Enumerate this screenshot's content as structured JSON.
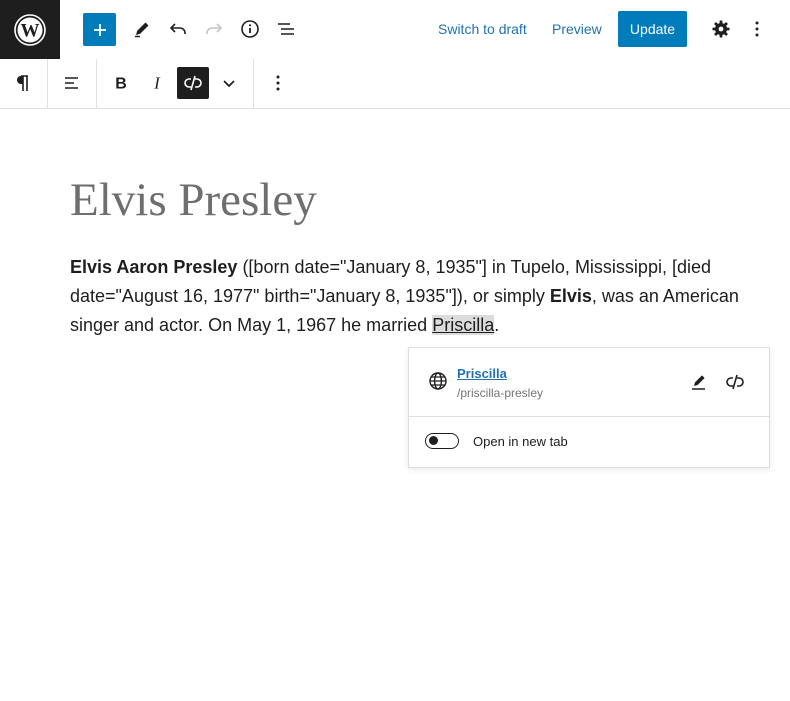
{
  "topbar": {
    "switch_draft_label": "Switch to draft",
    "preview_label": "Preview",
    "update_label": "Update"
  },
  "post": {
    "title": "Elvis Presley",
    "paragraph": {
      "bold_name": "Elvis Aaron Presley",
      "text_1": " ([born date=\"January 8, 1935\"] in Tupelo, Mississippi, [died date=\"August 16, 1977\" birth=\"January 8, 1935\"]), or simply ",
      "bold_short": "Elvis",
      "text_2": ", was an American singer and actor. On May 1, 1967 he married ",
      "link_text": "Priscilla",
      "text_3": "."
    }
  },
  "link_popover": {
    "title": "Priscilla",
    "url": "/priscilla-presley",
    "open_new_tab_label": "Open in new tab",
    "open_new_tab_checked": false
  },
  "colors": {
    "accent": "#007cba",
    "link": "#2271b1",
    "dark": "#1e1e1e"
  }
}
